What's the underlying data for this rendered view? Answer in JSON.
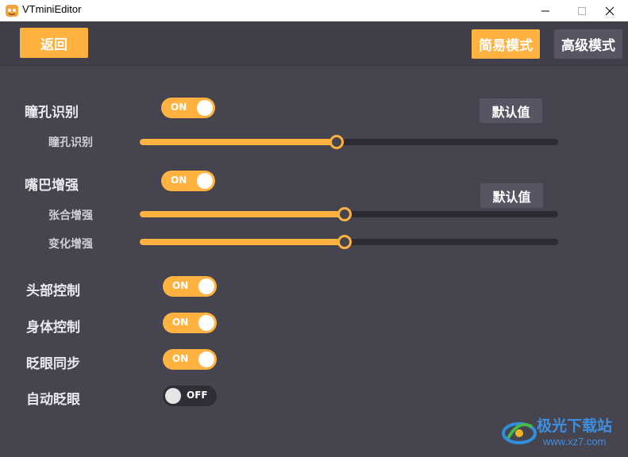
{
  "window": {
    "title": "VTminiEditor"
  },
  "topbar": {
    "back_label": "返回",
    "simple_mode_label": "简易模式",
    "advanced_mode_label": "高级模式"
  },
  "sections": {
    "pupil": {
      "label": "瞳孔识别",
      "toggle": "ON",
      "slider_label": "瞳孔识别",
      "slider_value": 0.47,
      "default_label": "默认值"
    },
    "mouth": {
      "label": "嘴巴增强",
      "toggle": "ON",
      "open_label": "张合增强",
      "open_value": 0.49,
      "change_label": "变化增强",
      "change_value": 0.49,
      "default_label": "默认值"
    },
    "head": {
      "label": "头部控制",
      "toggle": "ON"
    },
    "body": {
      "label": "身体控制",
      "toggle": "ON"
    },
    "blink_sync": {
      "label": "眨眼同步",
      "toggle": "ON"
    },
    "auto_blink": {
      "label": "自动眨眼",
      "toggle": "OFF"
    }
  },
  "watermark": {
    "text": "极光下载站",
    "url": "www.xz7.com"
  },
  "colors": {
    "accent": "#ffb23f",
    "background": "#45444f",
    "button_gray": "#565563"
  },
  "icons": {
    "app": "app-logo-icon",
    "minimize": "minimize-icon",
    "maximize": "maximize-icon",
    "close": "close-icon"
  }
}
